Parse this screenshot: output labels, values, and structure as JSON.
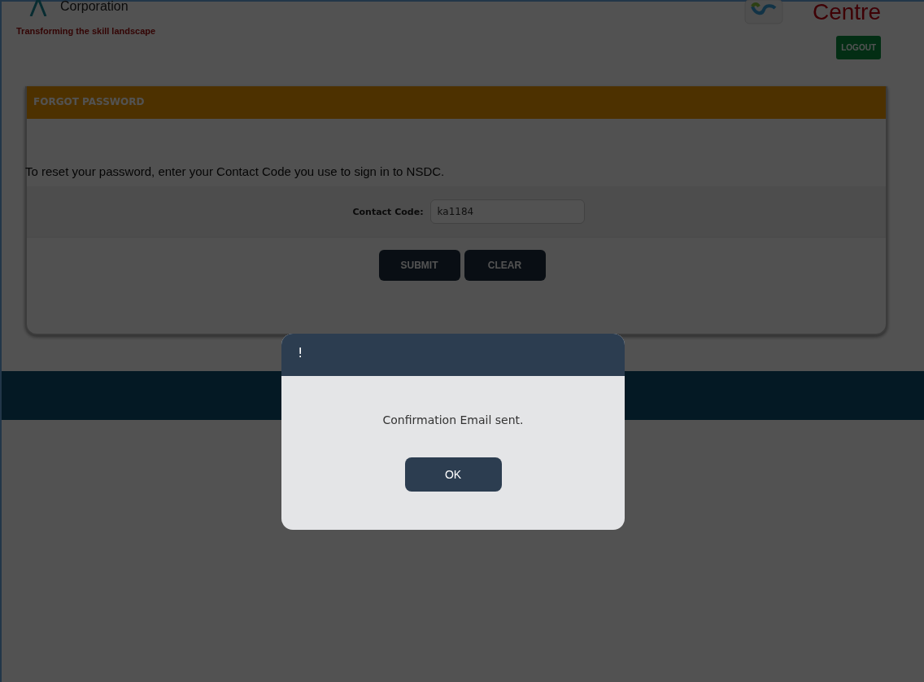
{
  "header": {
    "org_name": "Corporation",
    "tagline": "Transforming the skill landscape",
    "centre_title": "Centre",
    "logout_button": "LOGOUT"
  },
  "panel": {
    "title": "FORGOT PASSWORD",
    "instruction": "To reset your password, enter your Contact Code you use to sign in to NSDC.",
    "field": {
      "label": "Contact Code:",
      "value": "ka1184"
    },
    "buttons": [
      "SUBMIT",
      "CLEAR"
    ]
  },
  "dialog": {
    "title": "!",
    "message": "Confirmation Email sent.",
    "button": "OK"
  }
}
